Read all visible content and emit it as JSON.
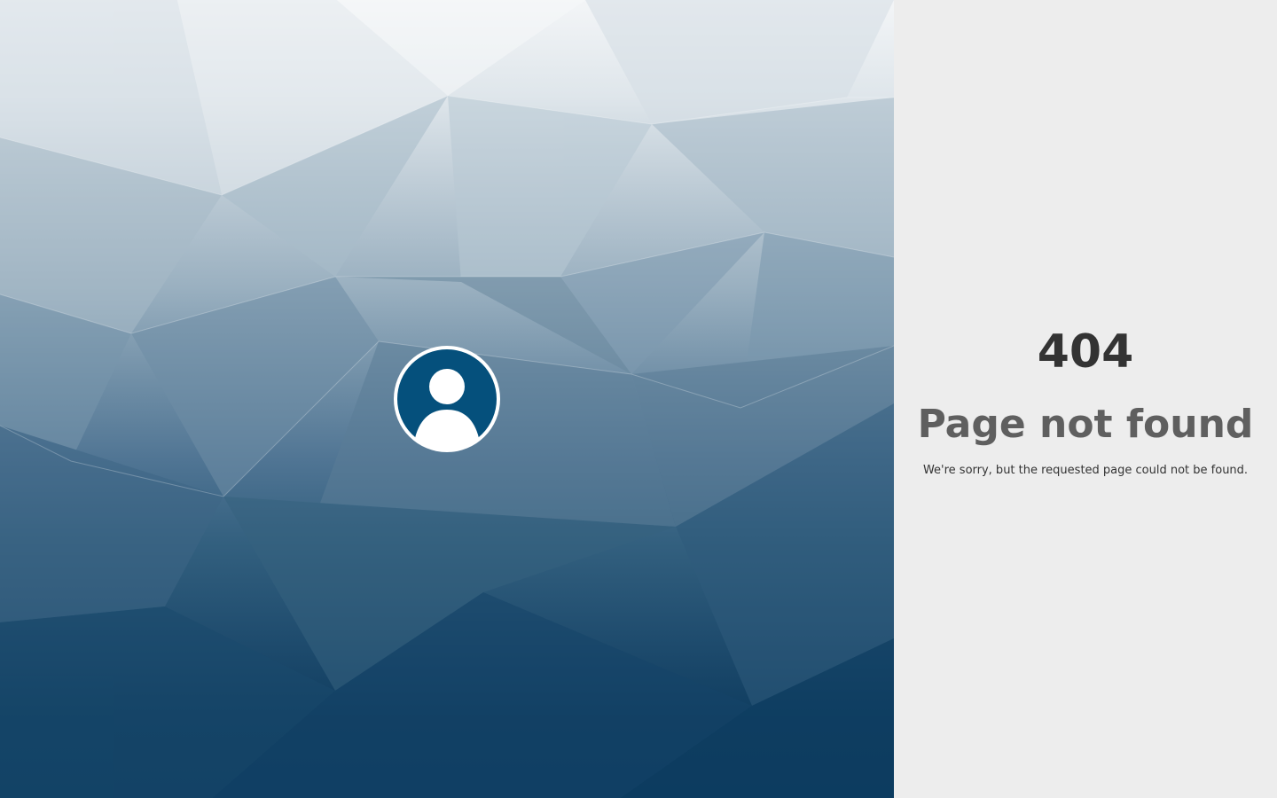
{
  "error": {
    "code": "404",
    "title": "Page not found",
    "message": "We're sorry, but the requested page could not be found."
  },
  "avatar": {
    "icon": "user-icon"
  },
  "colors": {
    "accent": "#05507c",
    "right_panel_bg": "#ededed",
    "code_text": "#333333",
    "title_text": "#5f5f5f"
  }
}
